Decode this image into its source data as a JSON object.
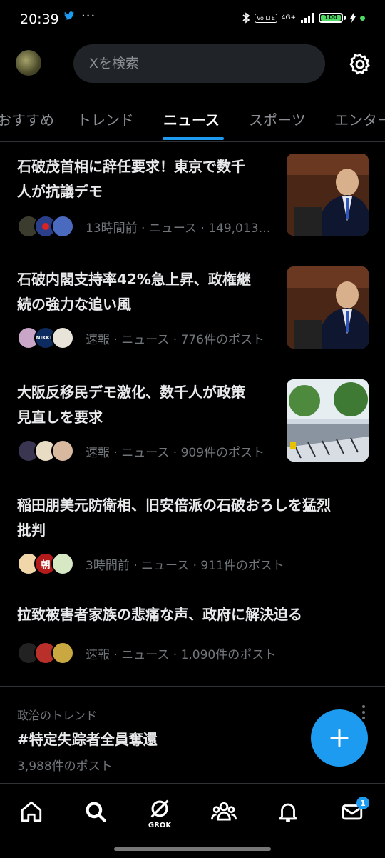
{
  "status_bar": {
    "time": "20:39",
    "dots": "···",
    "network": "4G+",
    "volte": "Vo LTE",
    "battery": "100"
  },
  "search": {
    "placeholder": "Xを検索"
  },
  "tabs": [
    {
      "label": "おすすめ",
      "active": false
    },
    {
      "label": "トレンド",
      "active": false
    },
    {
      "label": "ニュース",
      "active": true
    },
    {
      "label": "スポーツ",
      "active": false
    },
    {
      "label": "エンター",
      "active": false
    }
  ],
  "news": [
    {
      "title_line1": "石破茂首相に辞任要求！東京で数千",
      "title_line2": "人が抗議デモ",
      "meta": "13時間前 · ニュース · 149,013…"
    },
    {
      "title_line1": "石破内閣支持率42%急上昇、政権継",
      "title_line2": "続の強力な追い風",
      "meta": "速報 · ニュース · 776件のポスト",
      "face_label": "NIKKEI"
    },
    {
      "title_line1": "大阪反移民デモ激化、数千人が政策",
      "title_line2": "見直しを要求",
      "meta": "速報 · ニュース · 909件のポスト"
    },
    {
      "title_line1": "稲田朋美元防衛相、旧安倍派の石破おろしを猛烈",
      "title_line2": "批判",
      "meta": "3時間前 · ニュース · 911件のポスト",
      "face_label": "朝"
    },
    {
      "title_line1": "拉致被害者家族の悲痛な声、政府に解決迫る",
      "title_line2": "",
      "meta": "速報 · ニュース · 1,090件のポスト"
    }
  ],
  "trend": {
    "category": "政治のトレンド",
    "hashtag": "#特定失踪者全員奪還",
    "count": "3,988件のポスト"
  },
  "nav": {
    "grok_label": "GROK",
    "messages_badge": "1"
  },
  "colors": {
    "accent": "#1d9bf0",
    "background": "#000000",
    "muted": "#71767b"
  }
}
